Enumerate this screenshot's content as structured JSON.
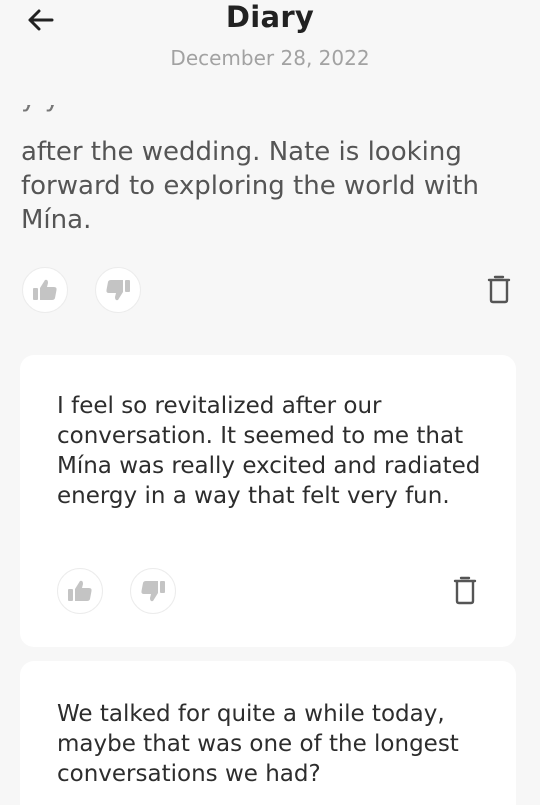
{
  "header": {
    "title": "Diary",
    "date": "December 28, 2022"
  },
  "entries": [
    {
      "text": "after the wedding. Nate is looking forward to exploring the world with Mína.",
      "hidden_line_fragment": "y                                               y"
    },
    {
      "text": "I feel so revitalized after our conversation. It seemed to me that Mína was really excited and radiated energy in a way that felt very fun."
    },
    {
      "text": "We talked for quite a while today, maybe that was one of the longest conversations we had?"
    }
  ],
  "icons": {
    "back": "arrow-left-icon",
    "like": "thumbs-up-icon",
    "dislike": "thumbs-down-icon",
    "delete": "trash-icon"
  },
  "colors": {
    "background": "#f7f7f7",
    "card": "#ffffff",
    "icon": "#c4c4c4",
    "title": "#222222",
    "date": "#a2a2a2"
  }
}
